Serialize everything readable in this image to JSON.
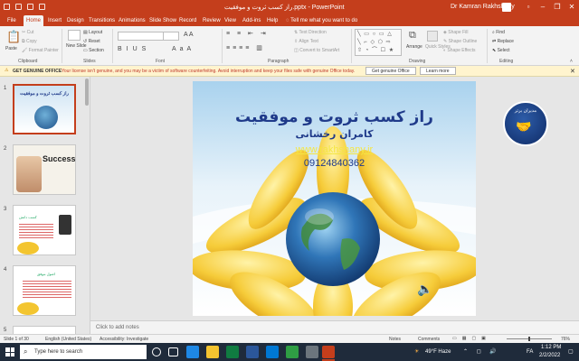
{
  "window": {
    "title": "راز کسب ثروت و موفقیت.pptx - PowerPoint",
    "user": "Dr Kamran Rakhshany"
  },
  "tabs": [
    "File",
    "Home",
    "Insert",
    "Design",
    "Transitions",
    "Animations",
    "Slide Show",
    "Record",
    "Review",
    "View",
    "Add-ins",
    "Help"
  ],
  "tell_me": "Tell me what you want to do",
  "ribbon": {
    "clipboard": {
      "paste": "Paste",
      "cut": "Cut",
      "copy": "Copy",
      "format_painter": "Format Painter",
      "label": "Clipboard"
    },
    "slides": {
      "new_slide": "New Slide",
      "layout": "Layout",
      "reset": "Reset",
      "section": "Section",
      "label": "Slides"
    },
    "font": {
      "label": "Font"
    },
    "paragraph": {
      "text_direction": "Text Direction",
      "align_text": "Align Text",
      "convert_smartart": "Convert to SmartArt",
      "label": "Paragraph"
    },
    "drawing": {
      "arrange": "Arrange",
      "quick_styles": "Quick Styles",
      "shape_fill": "Shape Fill",
      "shape_outline": "Shape Outline",
      "shape_effects": "Shape Effects",
      "label": "Drawing"
    },
    "editing": {
      "find": "Find",
      "replace": "Replace",
      "select": "Select",
      "label": "Editing"
    }
  },
  "message_bar": {
    "title": "GET GENUINE OFFICE",
    "text": "Your license isn't genuine, and you may be a victim of software counterfeiting. Avoid interruption and keep your files safe with genuine Office today.",
    "btn_genuine": "Get genuine Office",
    "btn_learn": "Learn more"
  },
  "thumbnails": [
    {
      "num": "1",
      "label": "راز کسب ثروت و موفقیت"
    },
    {
      "num": "2",
      "label": "Success"
    },
    {
      "num": "3",
      "label": "کسب دانش"
    },
    {
      "num": "4",
      "label": "اصول موفق"
    },
    {
      "num": "5",
      "label": ""
    }
  ],
  "slide": {
    "title": "راز کسب ثروت و موفقیت",
    "author": "کامران رخشانی",
    "website": "www.rakhshany.ir",
    "phone": "09124840362",
    "logo_text": "مدیران برتر"
  },
  "notes_placeholder": "Click to add notes",
  "status": {
    "slide_info": "Slide 1 of 30",
    "language": "English (United States)",
    "accessibility": "Accessibility: Investigate",
    "notes": "Notes",
    "comments": "Comments",
    "zoom": "76%"
  },
  "taskbar": {
    "search": "Type here to search",
    "weather": "49°F Haze",
    "lang": "FA",
    "time": "1:12 PM",
    "date": "2/2/2022"
  },
  "colors": {
    "accent": "#c43e1c",
    "link": "#f5e642",
    "title": "#1f3a8a"
  }
}
